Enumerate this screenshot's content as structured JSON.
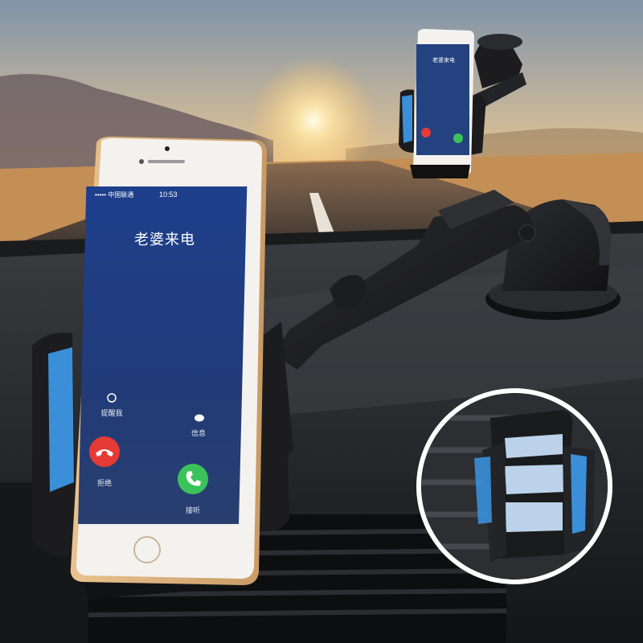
{
  "image": {
    "description_subjects": [
      "car-dashboard",
      "phone-holder",
      "smartphone",
      "inset-vent-mount"
    ],
    "colors": {
      "accent_blue": "#3a8fd8",
      "holder_black": "#1c1c1e",
      "screen_blue": "#1b3f8f",
      "sky_top": "#8a9fb4",
      "sun": "#fff1c2"
    }
  },
  "phone_main": {
    "status": {
      "carrier": "••••• 中国联通",
      "time": "10:53"
    },
    "caller": "老婆来电",
    "actions": {
      "remind": "提醒我",
      "message": "信息",
      "decline": "拒绝",
      "accept": "接听"
    }
  },
  "phone_small": {
    "caller": "老婆来电"
  }
}
